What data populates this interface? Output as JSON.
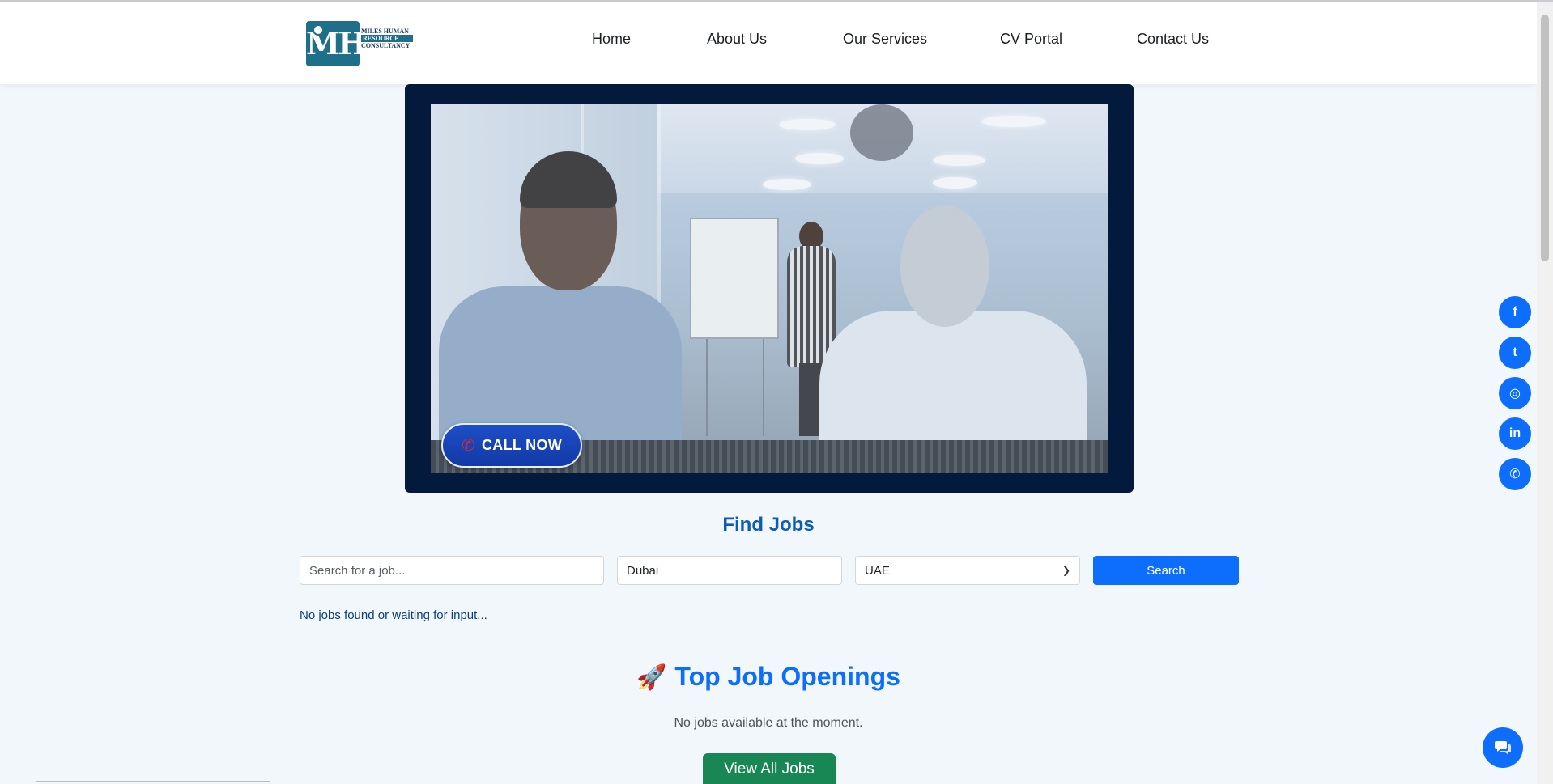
{
  "nav": {
    "items": [
      {
        "label": "Home"
      },
      {
        "label": "About Us"
      },
      {
        "label": "Our Services"
      },
      {
        "label": "CV Portal"
      },
      {
        "label": "Contact Us"
      }
    ]
  },
  "logo": {
    "mark": "MH",
    "line1": "MILES HUMAN",
    "line2": "RESOURCE",
    "line3": "CONSULTANCY"
  },
  "hero": {
    "call_button": "CALL NOW",
    "call_icon": "phone-icon"
  },
  "find_jobs": {
    "title": "Find Jobs",
    "search_placeholder": "Search for a job...",
    "location_value": "Dubai",
    "country_selected": "UAE",
    "search_button": "Search",
    "status_message": "No jobs found or waiting for input..."
  },
  "top_jobs": {
    "title": "Top Job Openings",
    "icon": "🚀",
    "empty_message": "No jobs available at the moment.",
    "view_all_button": "View All Jobs"
  },
  "social": {
    "items": [
      {
        "name": "facebook-icon",
        "glyph": "f"
      },
      {
        "name": "twitter-icon",
        "glyph": "t"
      },
      {
        "name": "instagram-icon",
        "glyph": "◎"
      },
      {
        "name": "linkedin-icon",
        "glyph": "in"
      },
      {
        "name": "whatsapp-icon",
        "glyph": "✆"
      }
    ]
  },
  "colors": {
    "brand_blue": "#0d6efd",
    "navy": "#041a3d",
    "green": "#198754",
    "page_bg": "#f1f7fb"
  }
}
